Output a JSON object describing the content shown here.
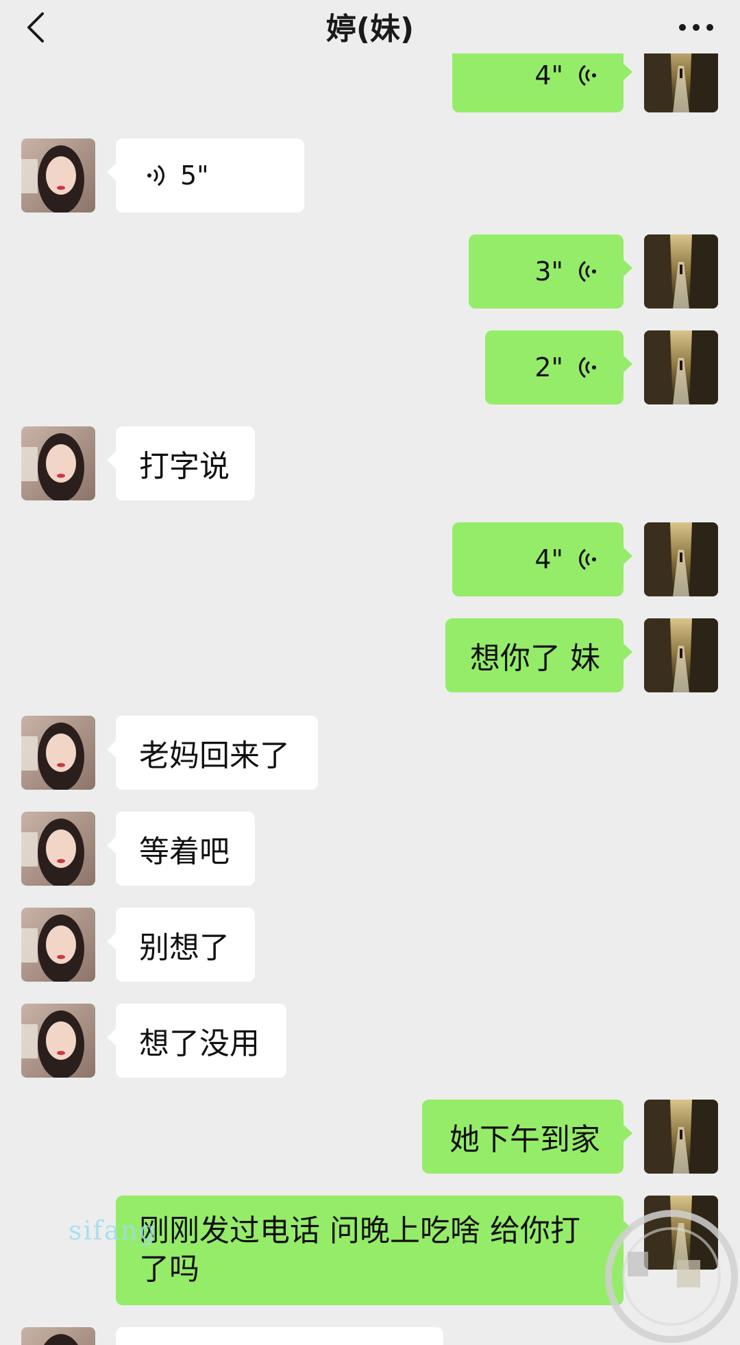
{
  "header": {
    "title": "婷(妹)"
  },
  "messages": [
    {
      "side": "right",
      "type": "voice",
      "duration": "4\""
    },
    {
      "side": "left",
      "type": "voice",
      "duration": "5\""
    },
    {
      "side": "right",
      "type": "voice",
      "duration": "3\""
    },
    {
      "side": "right",
      "type": "voice",
      "duration": "2\""
    },
    {
      "side": "left",
      "type": "text",
      "text": "打字说"
    },
    {
      "side": "right",
      "type": "voice",
      "duration": "4\""
    },
    {
      "side": "right",
      "type": "text",
      "text": "想你了 妹"
    },
    {
      "side": "left",
      "type": "text",
      "text": "老妈回来了"
    },
    {
      "side": "left",
      "type": "text",
      "text": "等着吧"
    },
    {
      "side": "left",
      "type": "text",
      "text": "别想了"
    },
    {
      "side": "left",
      "type": "text",
      "text": "想了没用"
    },
    {
      "side": "right",
      "type": "text",
      "text": "她下午到家"
    },
    {
      "side": "left",
      "type": "text",
      "text": "刚刚发过电话 问晚上吃啥 给你打了吗"
    }
  ],
  "watermark": {
    "text": "sifang"
  },
  "colors": {
    "background": "#ededed",
    "sent_bubble": "#95ec69",
    "received_bubble": "#ffffff"
  }
}
